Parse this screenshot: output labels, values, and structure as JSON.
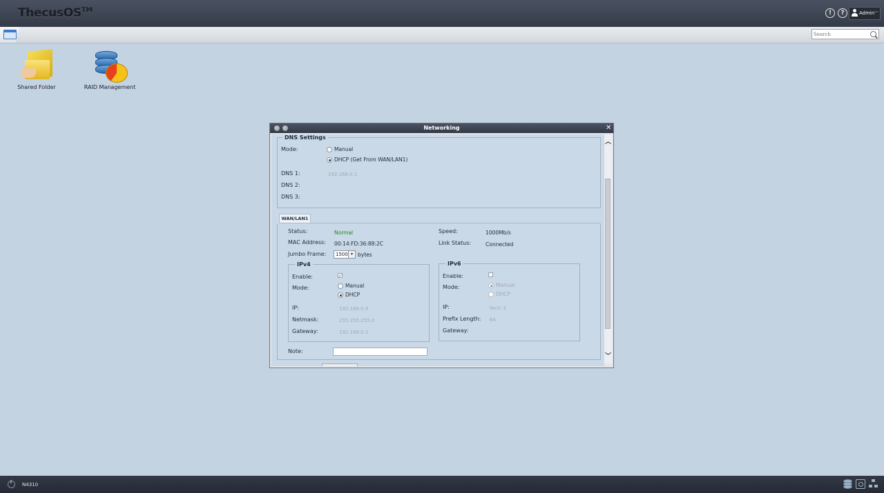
{
  "app": {
    "logo": "ThecusOS",
    "logo_tm": "TM",
    "model": "N4310"
  },
  "topbar": {
    "user": "Admin"
  },
  "search": {
    "placeholder": "Search"
  },
  "desktop": {
    "apps": [
      {
        "label": "Shared Folder"
      },
      {
        "label": "RAID Management"
      }
    ]
  },
  "window": {
    "title": "Networking",
    "dns": {
      "legend": "DNS Settings",
      "mode_label": "Mode:",
      "options": [
        "Manual",
        "DHCP (Get From WAN/LAN1)"
      ],
      "selected": "DHCP (Get From WAN/LAN1)",
      "dns1_label": "DNS 1:",
      "dns1_value": "192.168.0.1",
      "dns2_label": "DNS 2:",
      "dns3_label": "DNS 3:"
    },
    "tab": "WAN/LAN1",
    "status": {
      "status_label": "Status:",
      "status_value": "Normal",
      "mac_label": "MAC Address:",
      "mac_value": "00:14:FD:36:88:2C",
      "jumbo_label": "Jumbo Frame:",
      "jumbo_value": "1500",
      "jumbo_unit": "bytes",
      "speed_label": "Speed:",
      "speed_value": "1000Mb/s",
      "link_label": "Link Status:",
      "link_value": "Connected"
    },
    "ipv4": {
      "legend": "IPv4",
      "enable_label": "Enable:",
      "enabled": true,
      "mode_label": "Mode:",
      "options": [
        "Manual",
        "DHCP"
      ],
      "selected": "DHCP",
      "ip_label": "IP:",
      "ip_value": "192.168.0.9",
      "netmask_label": "Netmask:",
      "netmask_value": "255.255.255.0",
      "gateway_label": "Gateway:",
      "gateway_value": "192.168.0.1"
    },
    "ipv6": {
      "legend": "IPv6",
      "enable_label": "Enable:",
      "enabled": false,
      "mode_label": "Mode:",
      "options": [
        "Manual",
        "DHCP"
      ],
      "selected": "Manual",
      "ip_label": "IP:",
      "ip_value": "fec0::1",
      "prefix_label": "Prefix Length:",
      "prefix_value": "64",
      "gateway_label": "Gateway:"
    },
    "note_label": "Note:"
  }
}
